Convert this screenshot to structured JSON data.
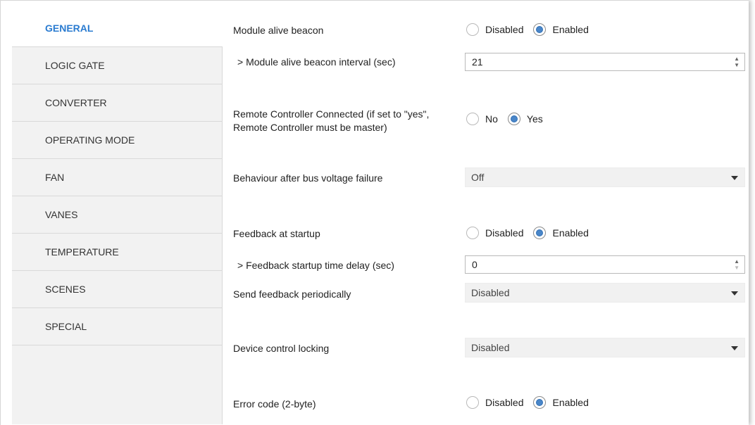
{
  "sidebar": {
    "items": [
      {
        "label": "GENERAL",
        "active": true
      },
      {
        "label": "LOGIC GATE"
      },
      {
        "label": "CONVERTER"
      },
      {
        "label": "OPERATING MODE"
      },
      {
        "label": "FAN"
      },
      {
        "label": "VANES"
      },
      {
        "label": "TEMPERATURE"
      },
      {
        "label": "SCENES"
      },
      {
        "label": "SPECIAL"
      }
    ]
  },
  "main": {
    "module_alive_beacon": {
      "label": "Module alive beacon",
      "options": [
        "Disabled",
        "Enabled"
      ],
      "selected": "Enabled"
    },
    "module_alive_beacon_interval": {
      "label": "> Module alive beacon interval (sec)",
      "value": "21"
    },
    "remote_controller_connected": {
      "label_line1": "Remote Controller Connected (if set to \"yes\",",
      "label_line2": "Remote Controller must be master)",
      "options": [
        "No",
        "Yes"
      ],
      "selected": "Yes"
    },
    "behaviour_after_bus_voltage_failure": {
      "label": "Behaviour after bus voltage failure",
      "value": "Off"
    },
    "feedback_at_startup": {
      "label": "Feedback at startup",
      "options": [
        "Disabled",
        "Enabled"
      ],
      "selected": "Enabled"
    },
    "feedback_startup_time_delay": {
      "label": "> Feedback startup time delay (sec)",
      "value": "0"
    },
    "send_feedback_periodically": {
      "label": "Send feedback periodically",
      "value": "Disabled"
    },
    "device_control_locking": {
      "label": "Device control locking",
      "value": "Disabled"
    },
    "error_code_2byte": {
      "label": "Error code (2-byte)",
      "options": [
        "Disabled",
        "Enabled"
      ],
      "selected": "Enabled"
    }
  },
  "colors": {
    "accent": "#2a7bd0",
    "sidebar_bg": "#f2f2f2",
    "radio_fill": "#4a86c8",
    "select_bg": "#f1f1f1"
  },
  "icons": {
    "spinner_up": "caret-up-icon",
    "spinner_down": "caret-down-icon",
    "dropdown": "chevron-down-icon"
  }
}
